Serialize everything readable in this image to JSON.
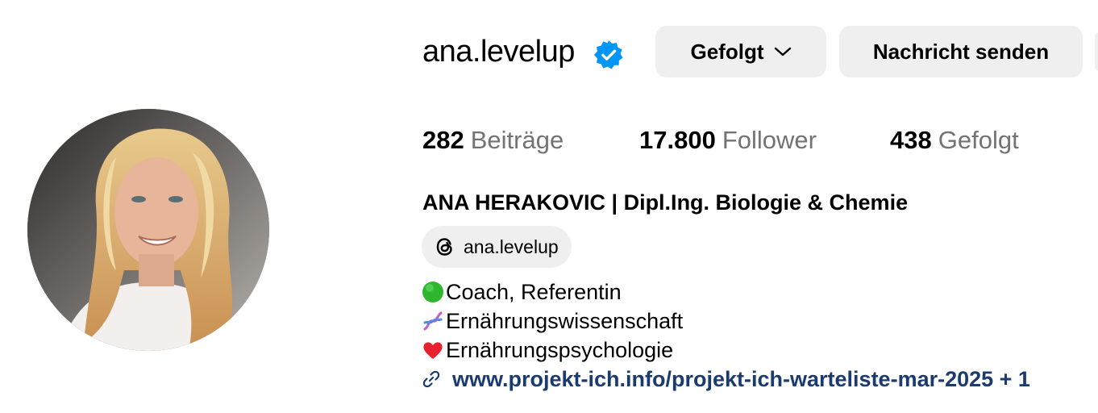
{
  "profile": {
    "username": "ana.levelup",
    "verified_icon": "verified-badge-icon",
    "full_name": "ANA HERAKOVIC | Dipl.Ing. Biologie & Chemie",
    "threads_handle": "ana.levelup",
    "threads_icon": "threads-icon"
  },
  "actions": {
    "follow_label": "Gefolgt",
    "follow_icon": "chevron-down-icon",
    "message_label": "Nachricht senden"
  },
  "stats": {
    "posts_count": "282",
    "posts_label": "Beiträge",
    "followers_count": "17.800",
    "followers_label": "Follower",
    "following_count": "438",
    "following_label": "Gefolgt"
  },
  "bio": {
    "lines": [
      {
        "emoji": "green-circle-icon",
        "text": "Coach, Referentin"
      },
      {
        "emoji": "dna-icon",
        "text": "Ernährungswissenschaft"
      },
      {
        "emoji": "red-heart-icon",
        "text": "Ernährungspsychologie"
      }
    ],
    "link_icon": "link-icon",
    "link_text": "www.projekt-ich.info/projekt-ich-warteliste-mar-2025 + 1"
  },
  "colors": {
    "accent_blue": "#0095f6",
    "link_color": "#1b3b6f",
    "button_bg": "#efefef",
    "muted_text": "#737373"
  }
}
